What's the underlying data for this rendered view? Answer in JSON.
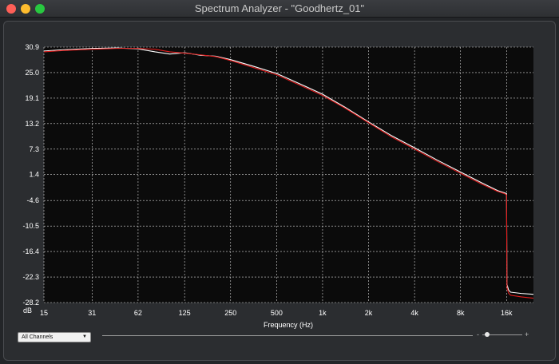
{
  "window": {
    "title": "Spectrum Analyzer - \"Goodhertz_01\""
  },
  "controls": {
    "channel_select": "All Channels",
    "zoom_minus": "-",
    "zoom_plus": "+",
    "zoom_level": 0.05
  },
  "colors": {
    "plot_background": "#0b0b0b",
    "grid": "#d8d8d8",
    "series_white": "#ffffff",
    "series_red": "#e01b1b"
  },
  "chart_data": {
    "type": "line",
    "xlabel": "Frequency (Hz)",
    "ylabel": "dB",
    "x_scale": "log",
    "xlim": [
      15,
      24000
    ],
    "ylim": [
      -28.2,
      30.9
    ],
    "x_ticks": [
      15,
      31,
      62,
      125,
      250,
      500,
      1000,
      2000,
      4000,
      8000,
      16000
    ],
    "x_tick_labels": [
      "15",
      "31",
      "62",
      "125",
      "250",
      "500",
      "1k",
      "2k",
      "4k",
      "8k",
      "16k"
    ],
    "y_ticks": [
      30.9,
      25.0,
      19.1,
      13.2,
      7.3,
      1.4,
      -4.6,
      -10.5,
      -16.4,
      -22.3,
      -28.2
    ],
    "y_tick_labels": [
      "30.9",
      "25.0",
      "19.1",
      "13.2",
      "7.3",
      "1.4",
      "-4.6",
      "-10.5",
      "-16.4",
      "-22.3",
      "-28.2"
    ],
    "grid": true,
    "series": [
      {
        "color": "#ffffff",
        "x": [
          15,
          20,
          31,
          45,
          62,
          80,
          100,
          125,
          160,
          200,
          250,
          350,
          500,
          700,
          1000,
          1400,
          2000,
          2800,
          4000,
          5600,
          8000,
          11000,
          14000,
          15500,
          16000,
          16100,
          16500,
          17000,
          20000,
          24000
        ],
        "y": [
          30.0,
          30.3,
          30.6,
          30.7,
          30.5,
          29.8,
          29.3,
          29.6,
          29.0,
          28.8,
          28.0,
          26.5,
          24.8,
          22.5,
          20.0,
          17.0,
          13.6,
          10.5,
          7.6,
          4.8,
          2.0,
          -0.5,
          -2.3,
          -2.8,
          -3.0,
          -24.0,
          -25.3,
          -25.8,
          -26.1,
          -26.3
        ]
      },
      {
        "color": "#e01b1b",
        "x": [
          15,
          20,
          31,
          45,
          62,
          80,
          100,
          125,
          160,
          200,
          250,
          350,
          500,
          700,
          1000,
          1400,
          2000,
          2800,
          4000,
          5600,
          8000,
          11000,
          14000,
          15500,
          16000,
          16100,
          16500,
          17000,
          20000,
          24000
        ],
        "y": [
          29.8,
          30.1,
          30.4,
          30.6,
          30.6,
          30.4,
          29.8,
          29.5,
          29.1,
          28.7,
          27.8,
          26.2,
          24.5,
          22.2,
          19.7,
          16.8,
          13.4,
          10.2,
          7.3,
          4.5,
          1.7,
          -0.8,
          -2.5,
          -3.0,
          -3.3,
          -24.8,
          -26.0,
          -26.5,
          -26.9,
          -27.2
        ]
      }
    ]
  }
}
